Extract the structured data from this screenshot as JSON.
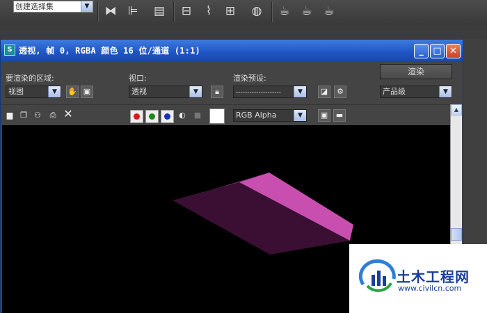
{
  "toolbar": {
    "selection_set": "创建选择集"
  },
  "window": {
    "title": "透视, 帧 0, RGBA 颜色 16 位/通道 (1:1)",
    "minimize": "_",
    "maximize": "□",
    "close": "✕"
  },
  "controls": {
    "area_label": "要渲染的区域:",
    "area_value": "视图",
    "viewport_label": "视口:",
    "viewport_value": "透视",
    "preset_label": "渲染预设:",
    "preset_value": "--------------------",
    "render_button": "渲染",
    "quality_value": "产品级"
  },
  "frame_toolbar": {
    "channel_value": "RGB Alpha",
    "clear": "✕"
  },
  "colors": {
    "red": "#e01818",
    "green": "#1a8a1a",
    "blue": "#1530c0",
    "shape_top": "#c84fb0",
    "shape_side": "#3a0f33"
  },
  "watermark": {
    "brand": "土木工程网",
    "url": "www.civilcn.com"
  }
}
